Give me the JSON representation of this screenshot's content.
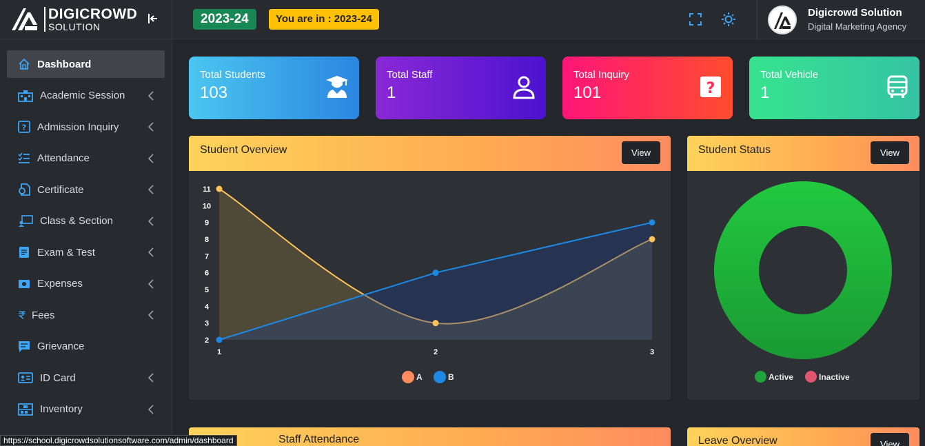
{
  "brand": {
    "name": "DIGICROWD",
    "sub": "SOLUTION"
  },
  "sidebar": {
    "items": [
      {
        "label": "Dashboard",
        "icon": "home-icon",
        "active": true,
        "has_chevron": false
      },
      {
        "label": "Academic Session",
        "icon": "building-icon",
        "active": false,
        "has_chevron": true
      },
      {
        "label": "Admission Inquiry",
        "icon": "question-icon",
        "active": false,
        "has_chevron": true
      },
      {
        "label": "Attendance",
        "icon": "checklist-icon",
        "active": false,
        "has_chevron": true
      },
      {
        "label": "Certificate",
        "icon": "certificate-icon",
        "active": false,
        "has_chevron": true
      },
      {
        "label": "Class & Section",
        "icon": "classroom-icon",
        "active": false,
        "has_chevron": true
      },
      {
        "label": "Exam & Test",
        "icon": "document-icon",
        "active": false,
        "has_chevron": true
      },
      {
        "label": "Expenses",
        "icon": "money-icon",
        "active": false,
        "has_chevron": true
      },
      {
        "label": "Fees",
        "icon": "rupee-icon",
        "active": false,
        "has_chevron": true
      },
      {
        "label": "Grievance",
        "icon": "chat-icon",
        "active": false,
        "has_chevron": false
      },
      {
        "label": "ID Card",
        "icon": "id-card-icon",
        "active": false,
        "has_chevron": true
      },
      {
        "label": "Inventory",
        "icon": "inventory-icon",
        "active": false,
        "has_chevron": true
      }
    ]
  },
  "header": {
    "year_badge": "2023-24",
    "year_info": "You are in : 2023-24",
    "user_name": "Digicrowd Solution",
    "user_role": "Digital Marketing Agency"
  },
  "cards": [
    {
      "label": "Total Students",
      "value": "103",
      "icon": "graduate-icon"
    },
    {
      "label": "Total Staff",
      "value": "1",
      "icon": "user-icon"
    },
    {
      "label": "Total Inquiry",
      "value": "101",
      "icon": "question-box-icon"
    },
    {
      "label": "Total Vehicle",
      "value": "1",
      "icon": "bus-icon"
    }
  ],
  "panels": {
    "overview": {
      "title": "Student Overview",
      "button": "View"
    },
    "status": {
      "title": "Student Status",
      "button": "View"
    },
    "staff": {
      "title": "Staff Attendance"
    },
    "leave": {
      "title": "Leave Overview",
      "button": "View"
    }
  },
  "chart_data": [
    {
      "type": "area",
      "categories": [
        "1",
        "2",
        "3"
      ],
      "y_ticks": [
        "2",
        "3",
        "4",
        "5",
        "6",
        "7",
        "8",
        "9",
        "10",
        "11"
      ],
      "ylim": [
        2,
        11
      ],
      "series": [
        {
          "name": "A",
          "values": [
            11,
            3,
            8
          ],
          "color": "#ffc35a",
          "legend_color": "#ff8c5f"
        },
        {
          "name": "B",
          "values": [
            2,
            6,
            9
          ],
          "color": "#1e88e5",
          "legend_color": "#1e88e5"
        }
      ],
      "legend": "bottom",
      "grid": false
    },
    {
      "type": "pie",
      "style": "donut",
      "labels": [
        "Active",
        "Inactive"
      ],
      "values": [
        1,
        0
      ],
      "colors": [
        "#1fa33a",
        "#e25570"
      ],
      "legend": "bottom"
    }
  ],
  "status_url": "https://school.digicrowdsolutionsoftware.com/admin/dashboard"
}
